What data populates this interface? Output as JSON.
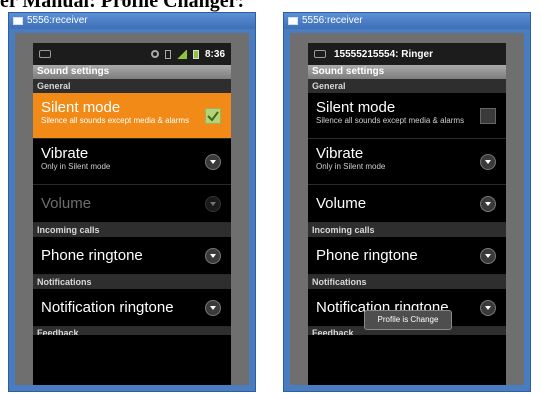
{
  "page_heading": "er Manual: Profile Changer:",
  "left": {
    "window_title": "5556:receiver",
    "status_time": "8:36",
    "screen_title": "Sound settings",
    "sections": [
      {
        "category": "General",
        "items": [
          {
            "title": "Silent mode",
            "summary": "Silence all sounds except media & alarms",
            "control": "checkbox",
            "checked": true,
            "selected": true
          },
          {
            "title": "Vibrate",
            "summary": "Only in Silent mode",
            "control": "chevron"
          },
          {
            "title": "Volume",
            "control": "chevron",
            "disabled": true
          }
        ]
      },
      {
        "category": "Incoming calls",
        "items": [
          {
            "title": "Phone ringtone",
            "control": "chevron"
          }
        ]
      },
      {
        "category": "Notifications",
        "items": [
          {
            "title": "Notification ringtone",
            "control": "chevron"
          }
        ]
      },
      {
        "category": "Feedback"
      }
    ]
  },
  "right": {
    "window_title": "5556:receiver",
    "status_notification": "15555215554: Ringer",
    "screen_title": "Sound settings",
    "sections": [
      {
        "category": "General",
        "items": [
          {
            "title": "Silent mode",
            "summary": "Silence all sounds except media & alarms",
            "control": "checkbox",
            "checked": false
          },
          {
            "title": "Vibrate",
            "summary": "Only in Silent mode",
            "control": "chevron"
          },
          {
            "title": "Volume",
            "control": "chevron"
          }
        ]
      },
      {
        "category": "Incoming calls",
        "items": [
          {
            "title": "Phone ringtone",
            "control": "chevron"
          }
        ]
      },
      {
        "category": "Notifications",
        "items": [
          {
            "title": "Notification ringtone",
            "control": "chevron"
          }
        ]
      },
      {
        "category": "Feedback"
      }
    ],
    "toast": "Profile is Change"
  },
  "colors": {
    "selected": "#f28a17",
    "window_frame": "#4a7cc0",
    "check_on": "#b6d37a"
  }
}
